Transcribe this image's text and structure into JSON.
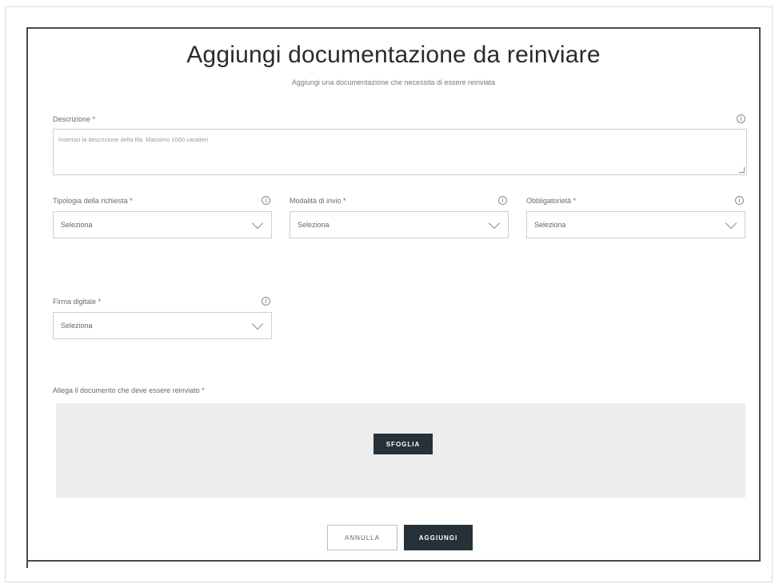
{
  "dialog": {
    "title": "Aggiungi documentazione da reinviare",
    "subtitle": "Aggiungi una documentazione che necessita di essere reinviata"
  },
  "fields": {
    "descrizione": {
      "label": "Descrizione *",
      "placeholder": "Inserisci la descrizione della fila. Massimo 1000 caratteri"
    },
    "tipologia": {
      "label": "Tipologia della richiesta *",
      "value": "Seleziona"
    },
    "modalita": {
      "label": "Modalità di invio *",
      "value": "Seleziona"
    },
    "obbligatorieta": {
      "label": "Obbligatorietà *",
      "value": "Seleziona"
    },
    "firma": {
      "label": "Firma digitale *",
      "value": "Seleziona"
    }
  },
  "attachment": {
    "label": "Allega il documento che deve essere reinviato *",
    "browse_label": "SFOGLIA"
  },
  "actions": {
    "cancel_label": "ANNULLA",
    "add_label": "AGGIUNGI"
  },
  "icons": {
    "info": "info-icon",
    "dropdown": "chevron-down-icon"
  },
  "colors": {
    "primary_button": "#263238",
    "dropzone_bg": "#eeeeee",
    "dialog_border": "#4a4a4a"
  }
}
